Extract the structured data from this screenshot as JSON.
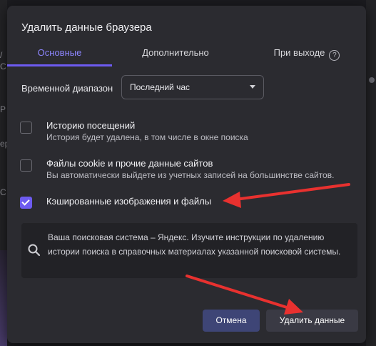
{
  "background": {
    "left_fragments": [
      "/",
      "С",
      "Р",
      "ер",
      "C"
    ]
  },
  "dialog": {
    "title": "Удалить данные браузера",
    "tabs": [
      {
        "label": "Основные",
        "active": true
      },
      {
        "label": "Дополнительно",
        "active": false
      },
      {
        "label": "При выходе",
        "active": false
      }
    ],
    "time_range": {
      "label": "Временной диапазон",
      "selected": "Последний час"
    },
    "options": [
      {
        "title": "Историю посещений",
        "desc": "История будет удалена, в том числе в окне поиска",
        "checked": false
      },
      {
        "title": "Файлы cookie и прочие данные сайтов",
        "desc": "Вы автоматически выйдете из учетных записей на большинстве сайтов.",
        "checked": false
      },
      {
        "title": "Кэшированные изображения и файлы",
        "desc": "",
        "checked": true
      }
    ],
    "info_text": "Ваша поисковая система – Яндекс. Изучите инструкции по удалению истории поиска в справочных материалах указанной поисковой системы.",
    "buttons": {
      "cancel": "Отмена",
      "delete": "Удалить данные"
    }
  },
  "colors": {
    "accent": "#6d5bf0",
    "annotation_arrow": "#e8312f",
    "cancel_button": "#3e4576",
    "dialog_bg": "#2b2b30"
  },
  "icons": {
    "help": "question-circle-icon",
    "search": "search-icon",
    "dropdown": "caret-down-icon",
    "check": "check-icon"
  }
}
